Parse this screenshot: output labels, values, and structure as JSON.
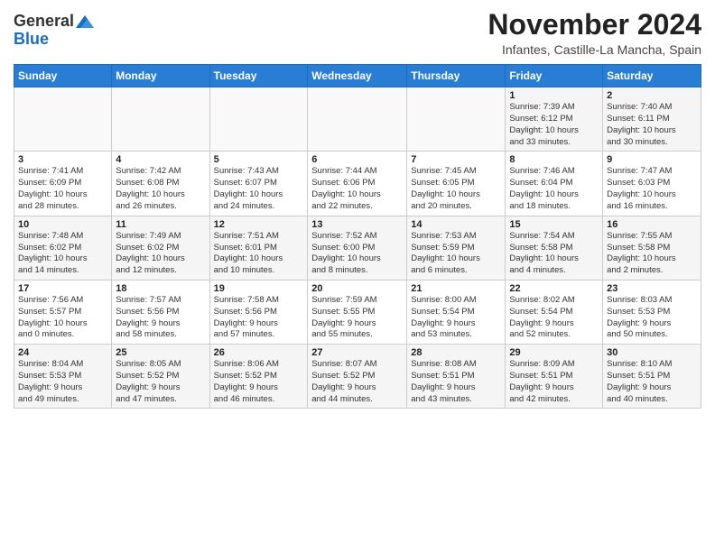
{
  "header": {
    "logo_general": "General",
    "logo_blue": "Blue",
    "month_title": "November 2024",
    "subtitle": "Infantes, Castille-La Mancha, Spain"
  },
  "weekdays": [
    "Sunday",
    "Monday",
    "Tuesday",
    "Wednesday",
    "Thursday",
    "Friday",
    "Saturday"
  ],
  "weeks": [
    [
      {
        "day": "",
        "info": ""
      },
      {
        "day": "",
        "info": ""
      },
      {
        "day": "",
        "info": ""
      },
      {
        "day": "",
        "info": ""
      },
      {
        "day": "",
        "info": ""
      },
      {
        "day": "1",
        "info": "Sunrise: 7:39 AM\nSunset: 6:12 PM\nDaylight: 10 hours\nand 33 minutes."
      },
      {
        "day": "2",
        "info": "Sunrise: 7:40 AM\nSunset: 6:11 PM\nDaylight: 10 hours\nand 30 minutes."
      }
    ],
    [
      {
        "day": "3",
        "info": "Sunrise: 7:41 AM\nSunset: 6:09 PM\nDaylight: 10 hours\nand 28 minutes."
      },
      {
        "day": "4",
        "info": "Sunrise: 7:42 AM\nSunset: 6:08 PM\nDaylight: 10 hours\nand 26 minutes."
      },
      {
        "day": "5",
        "info": "Sunrise: 7:43 AM\nSunset: 6:07 PM\nDaylight: 10 hours\nand 24 minutes."
      },
      {
        "day": "6",
        "info": "Sunrise: 7:44 AM\nSunset: 6:06 PM\nDaylight: 10 hours\nand 22 minutes."
      },
      {
        "day": "7",
        "info": "Sunrise: 7:45 AM\nSunset: 6:05 PM\nDaylight: 10 hours\nand 20 minutes."
      },
      {
        "day": "8",
        "info": "Sunrise: 7:46 AM\nSunset: 6:04 PM\nDaylight: 10 hours\nand 18 minutes."
      },
      {
        "day": "9",
        "info": "Sunrise: 7:47 AM\nSunset: 6:03 PM\nDaylight: 10 hours\nand 16 minutes."
      }
    ],
    [
      {
        "day": "10",
        "info": "Sunrise: 7:48 AM\nSunset: 6:02 PM\nDaylight: 10 hours\nand 14 minutes."
      },
      {
        "day": "11",
        "info": "Sunrise: 7:49 AM\nSunset: 6:02 PM\nDaylight: 10 hours\nand 12 minutes."
      },
      {
        "day": "12",
        "info": "Sunrise: 7:51 AM\nSunset: 6:01 PM\nDaylight: 10 hours\nand 10 minutes."
      },
      {
        "day": "13",
        "info": "Sunrise: 7:52 AM\nSunset: 6:00 PM\nDaylight: 10 hours\nand 8 minutes."
      },
      {
        "day": "14",
        "info": "Sunrise: 7:53 AM\nSunset: 5:59 PM\nDaylight: 10 hours\nand 6 minutes."
      },
      {
        "day": "15",
        "info": "Sunrise: 7:54 AM\nSunset: 5:58 PM\nDaylight: 10 hours\nand 4 minutes."
      },
      {
        "day": "16",
        "info": "Sunrise: 7:55 AM\nSunset: 5:58 PM\nDaylight: 10 hours\nand 2 minutes."
      }
    ],
    [
      {
        "day": "17",
        "info": "Sunrise: 7:56 AM\nSunset: 5:57 PM\nDaylight: 10 hours\nand 0 minutes."
      },
      {
        "day": "18",
        "info": "Sunrise: 7:57 AM\nSunset: 5:56 PM\nDaylight: 9 hours\nand 58 minutes."
      },
      {
        "day": "19",
        "info": "Sunrise: 7:58 AM\nSunset: 5:56 PM\nDaylight: 9 hours\nand 57 minutes."
      },
      {
        "day": "20",
        "info": "Sunrise: 7:59 AM\nSunset: 5:55 PM\nDaylight: 9 hours\nand 55 minutes."
      },
      {
        "day": "21",
        "info": "Sunrise: 8:00 AM\nSunset: 5:54 PM\nDaylight: 9 hours\nand 53 minutes."
      },
      {
        "day": "22",
        "info": "Sunrise: 8:02 AM\nSunset: 5:54 PM\nDaylight: 9 hours\nand 52 minutes."
      },
      {
        "day": "23",
        "info": "Sunrise: 8:03 AM\nSunset: 5:53 PM\nDaylight: 9 hours\nand 50 minutes."
      }
    ],
    [
      {
        "day": "24",
        "info": "Sunrise: 8:04 AM\nSunset: 5:53 PM\nDaylight: 9 hours\nand 49 minutes."
      },
      {
        "day": "25",
        "info": "Sunrise: 8:05 AM\nSunset: 5:52 PM\nDaylight: 9 hours\nand 47 minutes."
      },
      {
        "day": "26",
        "info": "Sunrise: 8:06 AM\nSunset: 5:52 PM\nDaylight: 9 hours\nand 46 minutes."
      },
      {
        "day": "27",
        "info": "Sunrise: 8:07 AM\nSunset: 5:52 PM\nDaylight: 9 hours\nand 44 minutes."
      },
      {
        "day": "28",
        "info": "Sunrise: 8:08 AM\nSunset: 5:51 PM\nDaylight: 9 hours\nand 43 minutes."
      },
      {
        "day": "29",
        "info": "Sunrise: 8:09 AM\nSunset: 5:51 PM\nDaylight: 9 hours\nand 42 minutes."
      },
      {
        "day": "30",
        "info": "Sunrise: 8:10 AM\nSunset: 5:51 PM\nDaylight: 9 hours\nand 40 minutes."
      }
    ]
  ]
}
